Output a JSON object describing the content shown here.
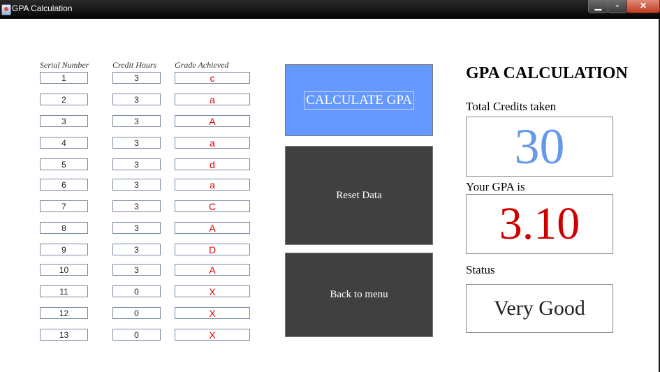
{
  "window": {
    "title": "GPA Calculation",
    "minimize": "▁",
    "maximize": "▫",
    "close": "✕"
  },
  "table": {
    "headers": {
      "serial": "Serial Number",
      "credit": "Credit Hours",
      "grade": "Grade Achieved"
    },
    "rows": [
      {
        "serial": "1",
        "credit": "3",
        "grade": "c"
      },
      {
        "serial": "2",
        "credit": "3",
        "grade": "a"
      },
      {
        "serial": "3",
        "credit": "3",
        "grade": "A"
      },
      {
        "serial": "4",
        "credit": "3",
        "grade": "a"
      },
      {
        "serial": "5",
        "credit": "3",
        "grade": "d"
      },
      {
        "serial": "6",
        "credit": "3",
        "grade": "a"
      },
      {
        "serial": "7",
        "credit": "3",
        "grade": "C"
      },
      {
        "serial": "8",
        "credit": "3",
        "grade": "A"
      },
      {
        "serial": "9",
        "credit": "3",
        "grade": "D"
      },
      {
        "serial": "10",
        "credit": "3",
        "grade": "A"
      },
      {
        "serial": "11",
        "credit": "0",
        "grade": "X"
      },
      {
        "serial": "12",
        "credit": "0",
        "grade": "X"
      },
      {
        "serial": "13",
        "credit": "0",
        "grade": "X"
      }
    ]
  },
  "buttons": {
    "calculate": "CALCULATE GPA",
    "reset": "Reset Data",
    "back": "Back to menu"
  },
  "result": {
    "title": "GPA CALCULATION",
    "credits_label": "Total Credits taken",
    "credits_value": "30",
    "gpa_label": "Your GPA is",
    "gpa_value": "3.10",
    "status_label": "Status",
    "status_value": "Very Good"
  },
  "colors": {
    "calculate_bg": "#6699ff",
    "dark_button_bg": "#404040",
    "grade_text": "#e00000",
    "credits_text": "#6699e8",
    "gpa_text": "#cc0000"
  }
}
